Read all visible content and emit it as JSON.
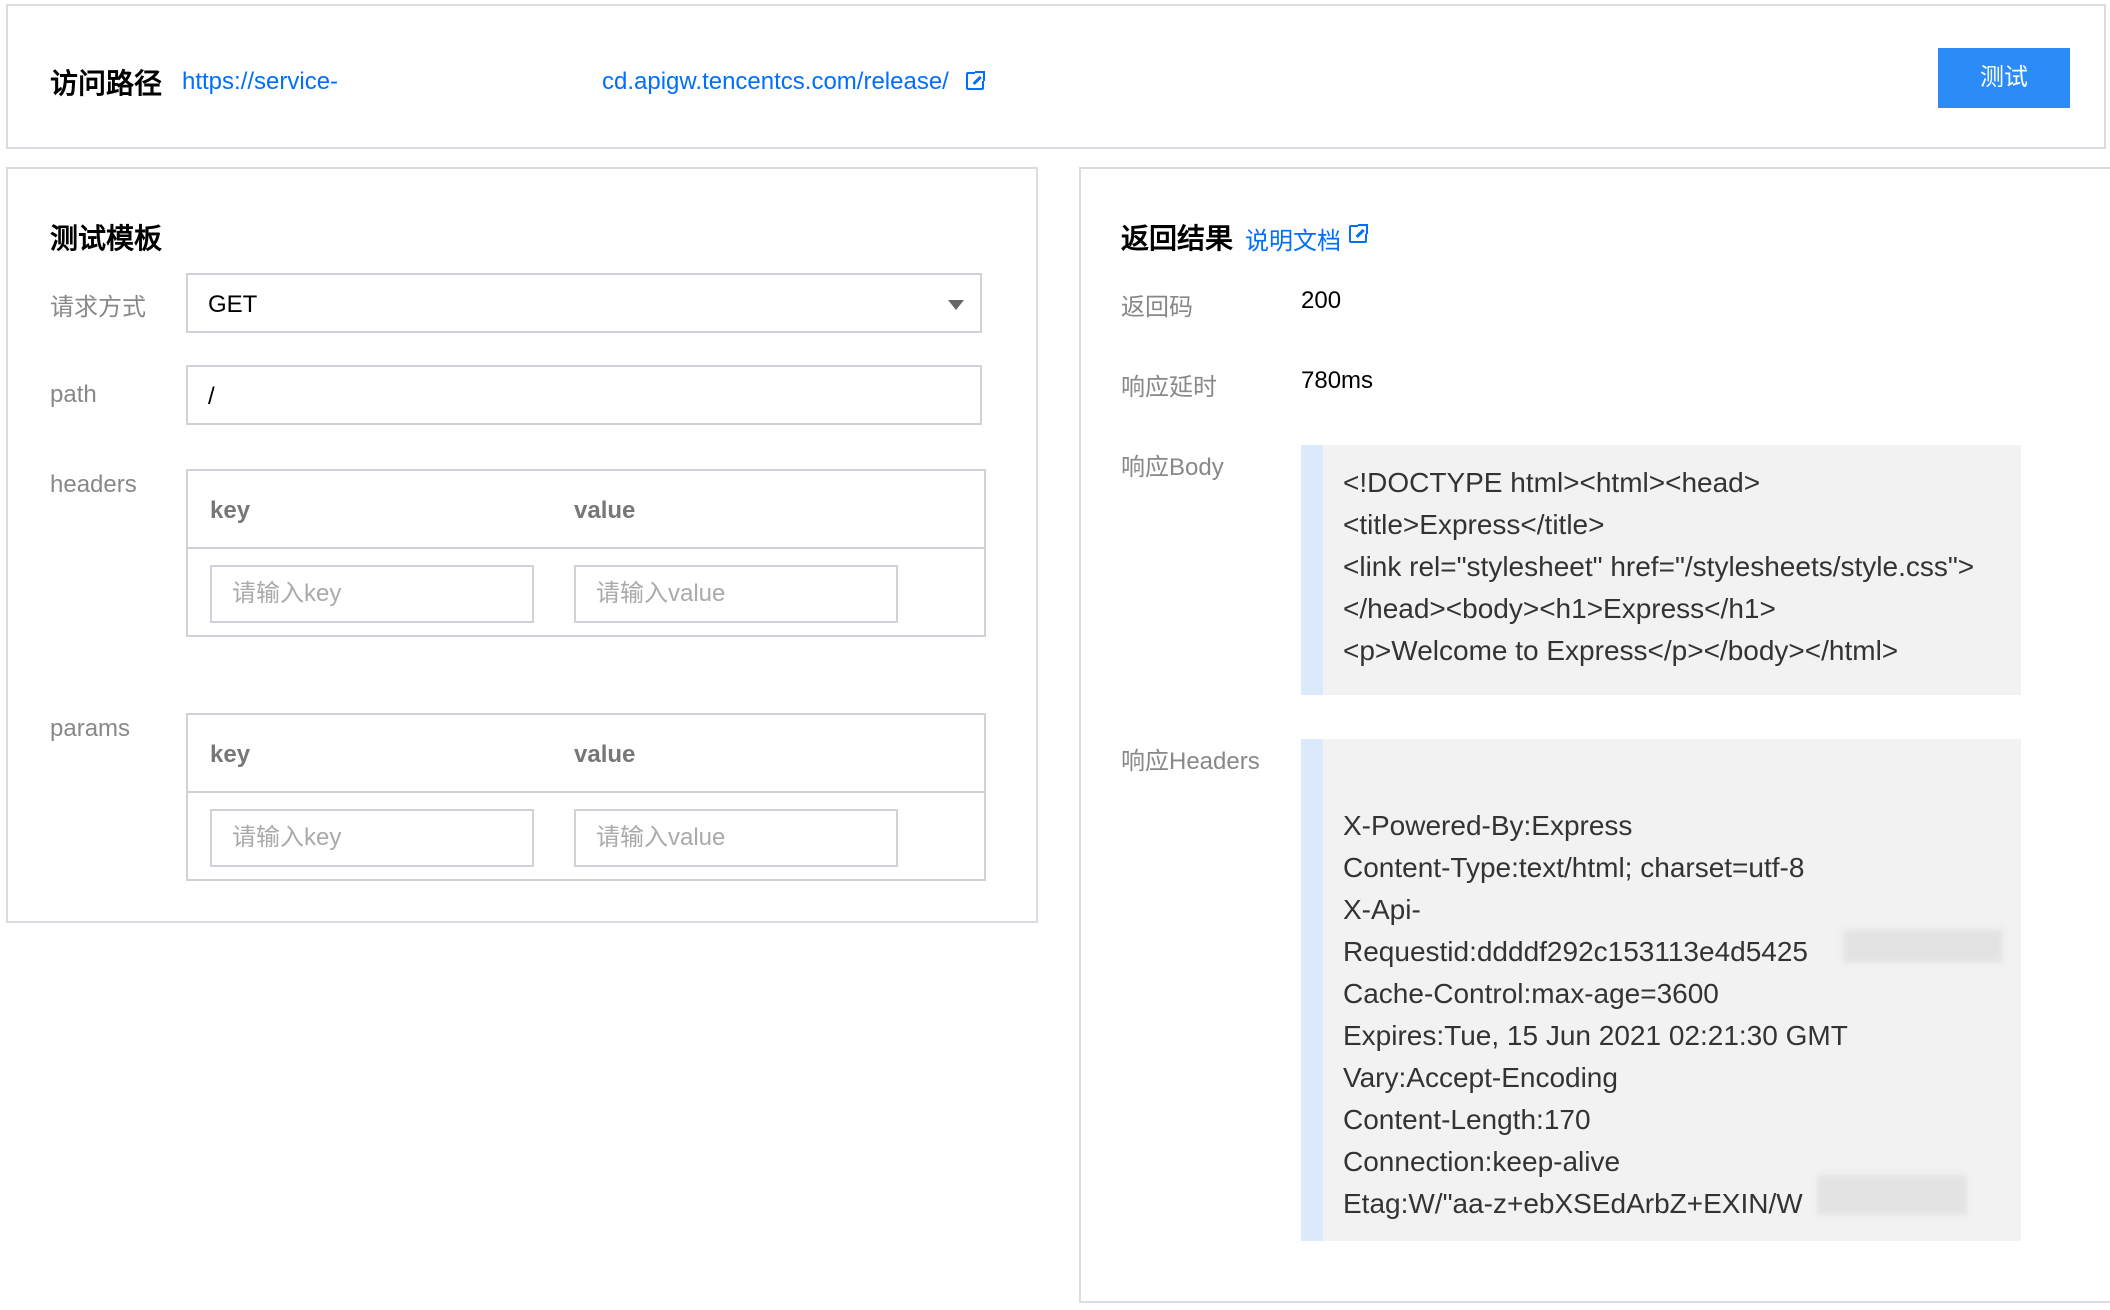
{
  "header": {
    "title": "访问路径",
    "url_prefix": "https://service-",
    "url_suffix": "cd.apigw.tencentcs.com/release/",
    "test_button": "测试"
  },
  "template": {
    "title": "测试模板",
    "method_label": "请求方式",
    "method_value": "GET",
    "path_label": "path",
    "path_value": "/",
    "headers_label": "headers",
    "params_label": "params",
    "col_key": "key",
    "col_value": "value",
    "key_placeholder": "请输入key",
    "value_placeholder": "请输入value"
  },
  "result": {
    "title": "返回结果",
    "doc_link": "说明文档",
    "code_label": "返回码",
    "code_value": "200",
    "latency_label": "响应延时",
    "latency_value": "780ms",
    "body_label": "响应Body",
    "body_lines": [
      "<!DOCTYPE html><html><head>",
      "<title>Express</title>",
      "<link rel=\"stylesheet\" href=\"/stylesheets/style.css\">",
      "</head><body><h1>Express</h1>",
      "<p>Welcome to Express</p></body></html>"
    ],
    "headers_label": "响应Headers",
    "header_lines": [
      "X-Powered-By:Express",
      "Content-Type:text/html; charset=utf-8",
      "X-Api-",
      "Requestid:ddddf292c153113e4d5425",
      "Cache-Control:max-age=3600",
      "Expires:Tue, 15 Jun 2021 02:21:30 GMT",
      "Vary:Accept-Encoding",
      "Content-Length:170",
      "Connection:keep-alive",
      "Etag:W/\"aa-z+ebXSEdArbZ+EXIN/W"
    ]
  }
}
